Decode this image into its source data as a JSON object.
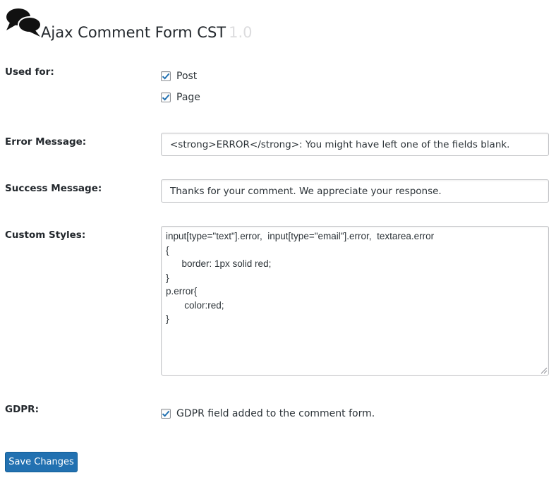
{
  "header": {
    "icon": "speech-bubbles-icon",
    "title": "Ajax Comment Form CST",
    "version": "1.0"
  },
  "used_for": {
    "label": "Used for:",
    "options": [
      {
        "label": "Post",
        "checked": true
      },
      {
        "label": "Page",
        "checked": true
      }
    ]
  },
  "error_message": {
    "label": "Error Message:",
    "value": "<strong>ERROR</strong>: You might have left one of the fields blank."
  },
  "success_message": {
    "label": "Success Message:",
    "value": "Thanks for your comment. We appreciate your response."
  },
  "custom_styles": {
    "label": "Custom Styles:",
    "value": "input[type=\"text\"].error,  input[type=\"email\"].error,  textarea.error\n{\n      border: 1px solid red;\n}\np.error{\n       color:red;\n}"
  },
  "gdpr": {
    "label": "GDPR:",
    "option_label": "GDPR field added to the comment form.",
    "checked": true
  },
  "save_button": {
    "label": "Save Changes"
  },
  "colors": {
    "accent": "#2271b1",
    "check": "#2271b1",
    "version": "#dcdcde"
  }
}
